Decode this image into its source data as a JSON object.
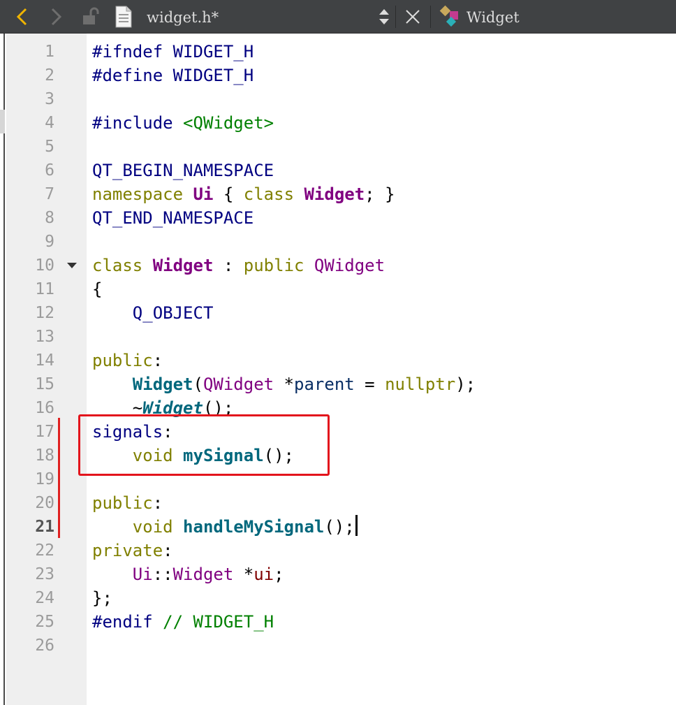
{
  "toolbar": {
    "file_name": "widget.h*",
    "class_name": "Widget",
    "icons": [
      "back-arrow-icon",
      "forward-arrow-icon",
      "unlock-icon",
      "file-icon",
      "up-down-arrows-icon",
      "close-icon",
      "class-icon"
    ]
  },
  "editor": {
    "current_line": 21,
    "lines": [
      {
        "n": "1",
        "tokens": [
          {
            "t": "#ifndef WIDGET_H",
            "c": "pp"
          }
        ]
      },
      {
        "n": "2",
        "tokens": [
          {
            "t": "#define WIDGET_H",
            "c": "pp"
          }
        ]
      },
      {
        "n": "3",
        "tokens": []
      },
      {
        "n": "4",
        "tokens": [
          {
            "t": "#include ",
            "c": "pp"
          },
          {
            "t": "<QWidget>",
            "c": "str"
          }
        ]
      },
      {
        "n": "5",
        "tokens": []
      },
      {
        "n": "6",
        "tokens": [
          {
            "t": "QT_BEGIN_NAMESPACE",
            "c": "mac"
          }
        ]
      },
      {
        "n": "7",
        "tokens": [
          {
            "t": "namespace ",
            "c": "kw"
          },
          {
            "t": "Ui",
            "c": "tyb"
          },
          {
            "t": " { ",
            "c": ""
          },
          {
            "t": "class ",
            "c": "kw"
          },
          {
            "t": "Widget",
            "c": "tyb"
          },
          {
            "t": "; }",
            "c": ""
          }
        ]
      },
      {
        "n": "8",
        "tokens": [
          {
            "t": "QT_END_NAMESPACE",
            "c": "mac"
          }
        ]
      },
      {
        "n": "9",
        "tokens": []
      },
      {
        "n": "10",
        "fold": true,
        "tokens": [
          {
            "t": "class ",
            "c": "kw"
          },
          {
            "t": "Widget",
            "c": "tyb"
          },
          {
            "t": " : ",
            "c": ""
          },
          {
            "t": "public ",
            "c": "kw"
          },
          {
            "t": "QWidget",
            "c": "ty"
          }
        ]
      },
      {
        "n": "11",
        "tokens": [
          {
            "t": "{",
            "c": ""
          }
        ]
      },
      {
        "n": "12",
        "tokens": [
          {
            "t": "    ",
            "c": ""
          },
          {
            "t": "Q_OBJECT",
            "c": "mac"
          }
        ]
      },
      {
        "n": "13",
        "tokens": []
      },
      {
        "n": "14",
        "tokens": [
          {
            "t": "public",
            "c": "kw"
          },
          {
            "t": ":",
            "c": ""
          }
        ]
      },
      {
        "n": "15",
        "tokens": [
          {
            "t": "    ",
            "c": ""
          },
          {
            "t": "Widget",
            "c": "fn"
          },
          {
            "t": "(",
            "c": ""
          },
          {
            "t": "QWidget",
            "c": "ty"
          },
          {
            "t": " *",
            "c": ""
          },
          {
            "t": "parent",
            "c": "par"
          },
          {
            "t": " = ",
            "c": ""
          },
          {
            "t": "nullptr",
            "c": "kw"
          },
          {
            "t": ");",
            "c": ""
          }
        ]
      },
      {
        "n": "16",
        "tokens": [
          {
            "t": "    ~",
            "c": ""
          },
          {
            "t": "Widget",
            "c": "fni"
          },
          {
            "t": "();",
            "c": ""
          }
        ]
      },
      {
        "n": "17",
        "tokens": [
          {
            "t": "signals",
            "c": "lbl"
          },
          {
            "t": ":",
            "c": ""
          }
        ]
      },
      {
        "n": "18",
        "tokens": [
          {
            "t": "    ",
            "c": ""
          },
          {
            "t": "void ",
            "c": "kw"
          },
          {
            "t": "mySignal",
            "c": "fn"
          },
          {
            "t": "();",
            "c": ""
          }
        ]
      },
      {
        "n": "19",
        "tokens": []
      },
      {
        "n": "20",
        "tokens": [
          {
            "t": "public",
            "c": "kw"
          },
          {
            "t": ":",
            "c": ""
          }
        ]
      },
      {
        "n": "21",
        "cursor": true,
        "tokens": [
          {
            "t": "    ",
            "c": ""
          },
          {
            "t": "void ",
            "c": "kw"
          },
          {
            "t": "handleMySignal",
            "c": "fn"
          },
          {
            "t": "();",
            "c": ""
          }
        ]
      },
      {
        "n": "22",
        "tokens": [
          {
            "t": "private",
            "c": "kw"
          },
          {
            "t": ":",
            "c": ""
          }
        ]
      },
      {
        "n": "23",
        "tokens": [
          {
            "t": "    ",
            "c": ""
          },
          {
            "t": "Ui",
            "c": "ty"
          },
          {
            "t": "::",
            "c": ""
          },
          {
            "t": "Widget",
            "c": "ty"
          },
          {
            "t": " *",
            "c": ""
          },
          {
            "t": "ui",
            "c": "mem"
          },
          {
            "t": ";",
            "c": ""
          }
        ]
      },
      {
        "n": "24",
        "tokens": [
          {
            "t": "};",
            "c": ""
          }
        ]
      },
      {
        "n": "25",
        "tokens": [
          {
            "t": "#endif ",
            "c": "pp"
          },
          {
            "t": "// WIDGET_H",
            "c": "cmt"
          }
        ]
      },
      {
        "n": "26",
        "tokens": []
      }
    ]
  },
  "colors": {
    "toolbar_bg": "#404244",
    "highlight_box": "#e3141c",
    "back_arrow": "#f0b400"
  }
}
